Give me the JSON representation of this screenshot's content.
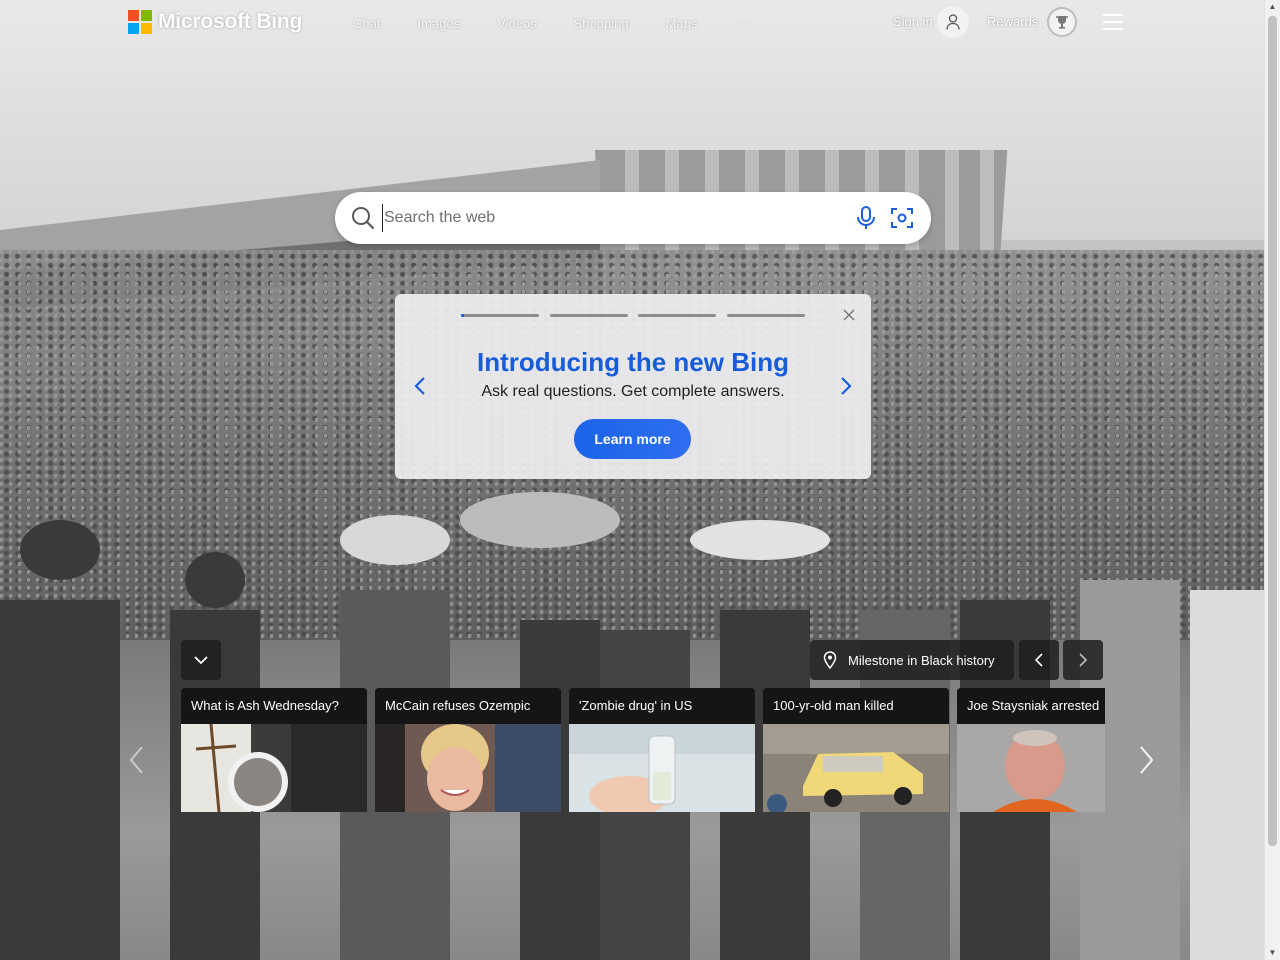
{
  "brand": {
    "name": "Microsoft Bing",
    "logo_colors": [
      "#f25022",
      "#7fba00",
      "#00a4ef",
      "#ffb900"
    ]
  },
  "nav": {
    "items": [
      {
        "label": "Chat"
      },
      {
        "label": "Images"
      },
      {
        "label": "Videos"
      },
      {
        "label": "Shopping"
      },
      {
        "label": "Maps"
      }
    ],
    "more_label": "···"
  },
  "account": {
    "sign_in_label": "Sign in",
    "rewards_label": "Rewards"
  },
  "search": {
    "placeholder": "Search the web",
    "value": ""
  },
  "promo": {
    "title": "Introducing the new Bing",
    "subtitle": "Ask real questions. Get complete answers.",
    "button_label": "Learn more",
    "slides_total": 4,
    "current_slide": 1,
    "current_slide_progress": 0.04,
    "accent_color": "#175dd9"
  },
  "image_of_day": {
    "location_label": "Milestone in Black history"
  },
  "news": {
    "cards": [
      {
        "title": "What is Ash Wednesday?",
        "icon": "ash-wednesday-image"
      },
      {
        "title": "McCain refuses Ozempic",
        "icon": "portrait-image"
      },
      {
        "title": "'Zombie drug' in US",
        "icon": "vial-image"
      },
      {
        "title": "100-yr-old man killed",
        "icon": "car-image"
      },
      {
        "title": "Joe Staysniak arrested",
        "icon": "mugshot-image"
      }
    ]
  }
}
